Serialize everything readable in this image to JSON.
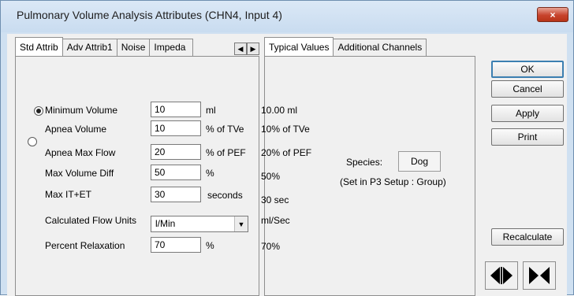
{
  "window": {
    "title": "Pulmonary Volume Analysis Attributes  (CHN4, Input 4)",
    "close_glyph": "×"
  },
  "left_tabs": [
    {
      "label": "Std Attrib",
      "active": true
    },
    {
      "label": "Adv Attrib1",
      "active": false
    },
    {
      "label": "Noise",
      "active": false
    },
    {
      "label": "Impeda",
      "active": false
    }
  ],
  "right_tabs": [
    {
      "label": "Typical Values",
      "active": true
    },
    {
      "label": "Additional Channels",
      "active": false
    }
  ],
  "tab_scroll": {
    "left_glyph": "◀",
    "right_glyph": "▶"
  },
  "params": [
    {
      "label": "Minimum Volume",
      "value": "10",
      "unit": "ml",
      "typical": "10.00 ml"
    },
    {
      "label": "Apnea Volume",
      "value": "10",
      "unit": "% of TVe",
      "typical": "10% of TVe"
    },
    {
      "label": "Apnea Max Flow",
      "value": "20",
      "unit": "% of PEF",
      "typical": "20% of PEF"
    },
    {
      "label": "Max Volume Diff",
      "value": "50",
      "unit": "%",
      "typical": "50%"
    },
    {
      "label": "Max  IT+ET",
      "value": "30",
      "unit": "seconds",
      "typical": "30 sec"
    }
  ],
  "flow_units": {
    "label": "Calculated Flow Units",
    "value": "l/Min",
    "typical": "ml/Sec"
  },
  "relaxation": {
    "label": "Percent Relaxation",
    "value": "70",
    "unit": "%",
    "typical": "70%"
  },
  "radio": {
    "minimum_volume_selected": true,
    "apnea_selected": false
  },
  "species": {
    "label": "Species:",
    "value": "Dog",
    "note": "(Set in P3 Setup : Group)"
  },
  "buttons": {
    "ok": "OK",
    "cancel": "Cancel",
    "apply": "Apply",
    "print": "Print",
    "recalculate": "Recalculate"
  },
  "colors": {
    "title_bar": "#cfe0f1",
    "close_button": "#c7432c",
    "dialog_face": "#f0f0f0",
    "default_button_border": "#3c7fb1"
  }
}
